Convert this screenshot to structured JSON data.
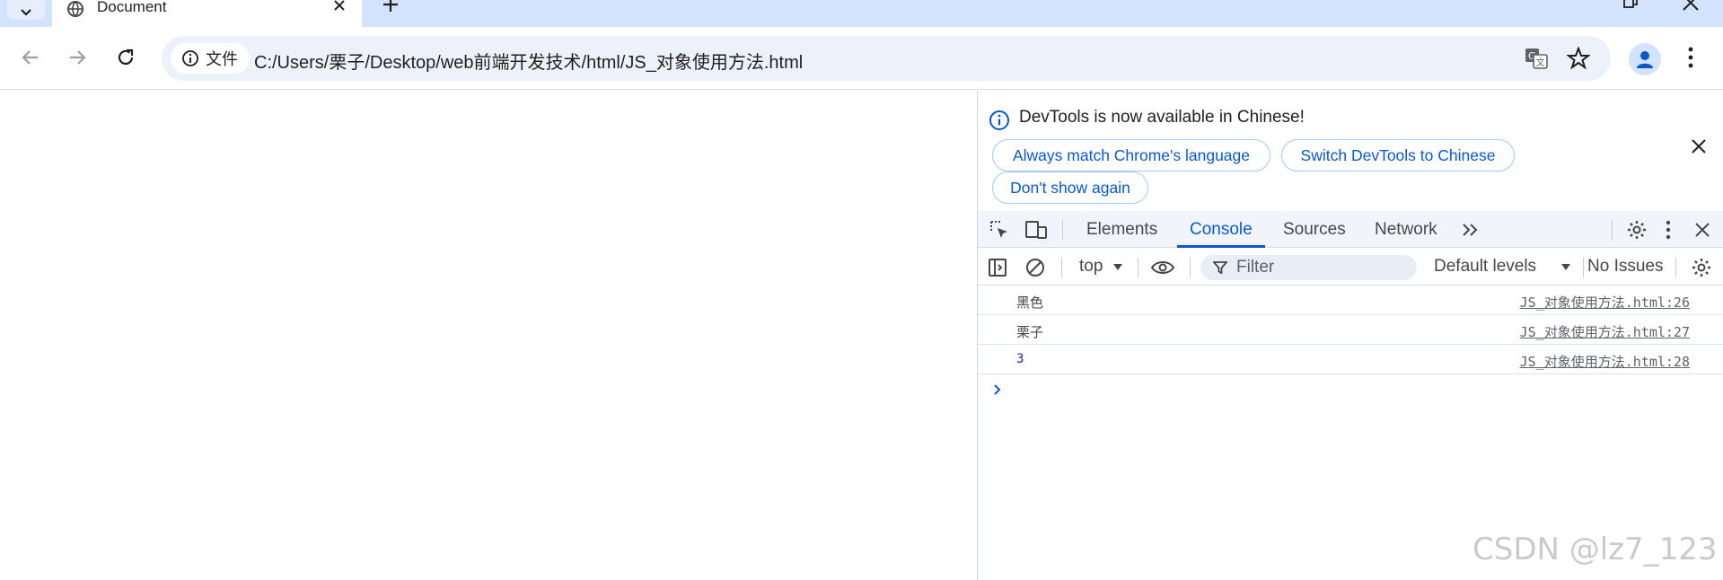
{
  "browser": {
    "tab": {
      "title": "Document"
    },
    "omnibox": {
      "chip_label": "文件",
      "url": "C:/Users/栗子/Desktop/web前端开发技术/html/JS_对象使用方法.html"
    }
  },
  "devtools": {
    "infobar": {
      "message": "DevTools is now available in Chinese!",
      "buttons": [
        "Always match Chrome's language",
        "Switch DevTools to Chinese",
        "Don't show again"
      ]
    },
    "tabs": [
      "Elements",
      "Console",
      "Sources",
      "Network"
    ],
    "active_tab": "Console",
    "console_toolbar": {
      "context": "top",
      "filter_placeholder": "Filter",
      "levels": "Default levels",
      "issues": "No Issues"
    },
    "messages": [
      {
        "text": "黑色",
        "source": "JS_对象使用方法.html:26"
      },
      {
        "text": "栗子",
        "source": "JS_对象使用方法.html:27"
      },
      {
        "text": "3",
        "source": "JS_对象使用方法.html:28"
      }
    ]
  },
  "watermark": "CSDN @lz7_123",
  "colors": {
    "accent": "#0b57d0",
    "tabstrip": "#d3e3fd",
    "omnibox": "#edf2fa"
  }
}
